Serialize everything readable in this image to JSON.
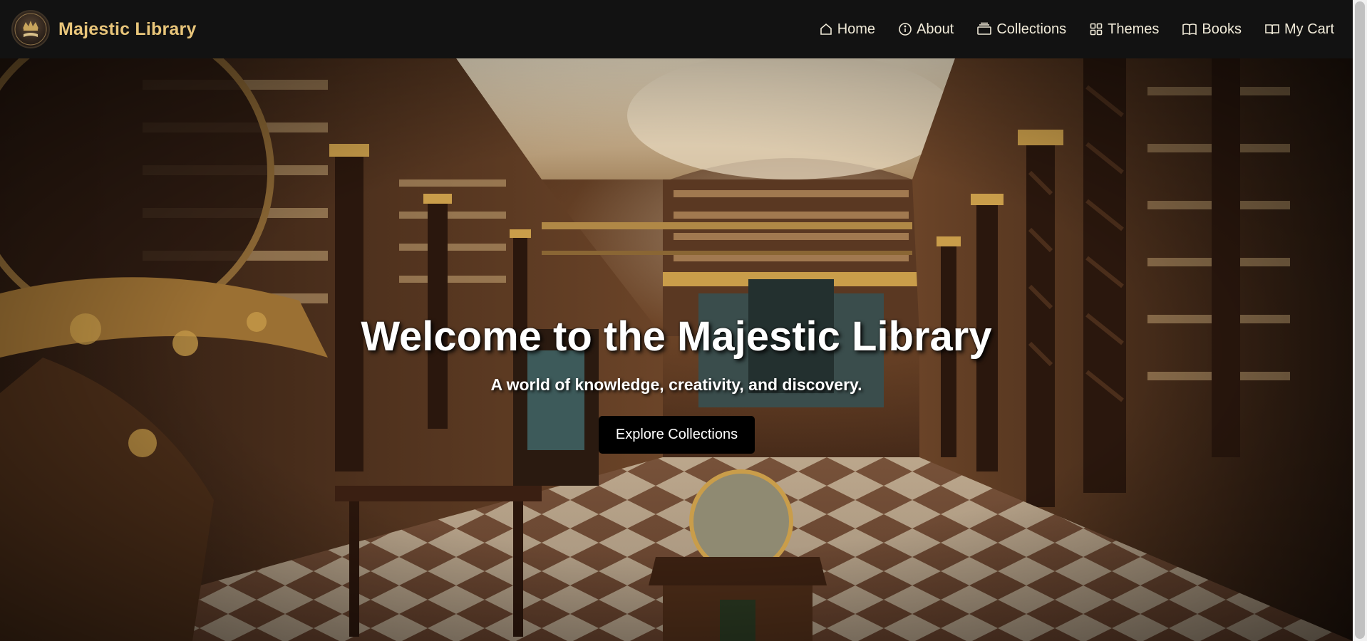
{
  "brand": {
    "logo_icon": "library-crest-icon",
    "logo_text": "MAJESTIC",
    "name": "Majestic Library"
  },
  "nav": {
    "items": [
      {
        "label": "Home",
        "icon": "home-icon"
      },
      {
        "label": "About",
        "icon": "info-icon"
      },
      {
        "label": "Collections",
        "icon": "archive-icon"
      },
      {
        "label": "Themes",
        "icon": "grid-icon"
      },
      {
        "label": "Books",
        "icon": "book-icon"
      },
      {
        "label": "My Cart",
        "icon": "book-open-icon"
      }
    ]
  },
  "hero": {
    "background": "ornate baroque library hall with bookshelves, twisted columns, globes and checkered floor",
    "title": "Welcome to the Majestic Library",
    "subtitle": "A world of knowledge, creativity, and discovery.",
    "button_label": "Explore Collections"
  },
  "colors": {
    "navbar_bg": "#121212",
    "brand_gold": "#e8c57a",
    "nav_text": "#f0ead8",
    "button_bg": "#000000",
    "button_text": "#ffffff"
  }
}
